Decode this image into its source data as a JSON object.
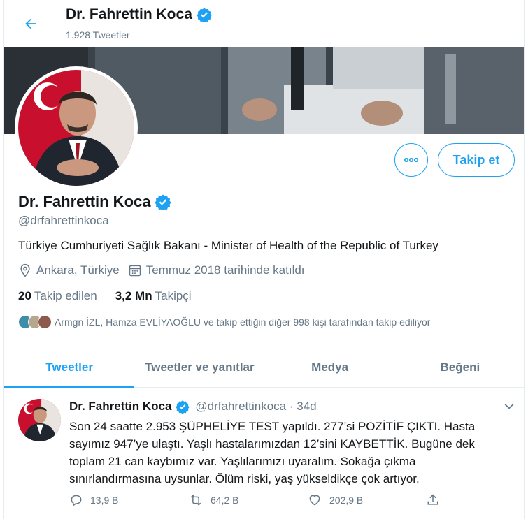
{
  "header": {
    "name": "Dr. Fahrettin Koca",
    "tweet_count": "1.928 Tweetler"
  },
  "profile": {
    "name": "Dr. Fahrettin Koca",
    "handle": "@drfahrettinkoca",
    "bio": "Türkiye Cumhuriyeti Sağlık Bakanı - Minister of Health of the Republic of Turkey",
    "location": "Ankara, Türkiye",
    "joined": "Temmuz 2018 tarihinde katıldı",
    "following_count": "20",
    "following_label": "Takip edilen",
    "followers_count": "3,2 Mn",
    "followers_label": "Takipçi",
    "followed_by": "Armgn İZL, Hamza EVLİYAOĞLU ve takip ettiğin diğer 998 kişi tarafından takip ediliyor",
    "follow_label": "Takip et"
  },
  "tabs": [
    {
      "label": "Tweetler"
    },
    {
      "label": "Tweetler ve yanıtlar"
    },
    {
      "label": "Medya"
    },
    {
      "label": "Beğeni"
    }
  ],
  "tweet": {
    "name": "Dr. Fahrettin Koca",
    "handle": "@drfahrettinkoca · 34d",
    "text": "Son 24 saatte 2.953 ŞÜPHELİYE TEST yapıldı. 277’si POZİTİF ÇIKTI. Hasta sayımız 947’ye ulaştı. Yaşlı hastalarımızdan 12’sini KAYBETTİK. Bugüne dek toplam 21 can kaybımız var. Yaşlılarımızı uyaralım. Sokağa çıkma sınırlandırmasına uysunlar. Ölüm riski, yaş yükseldikçe çok artıyor.",
    "replies": "13,9 B",
    "retweets": "64,2 B",
    "likes": "202,9 B"
  },
  "colors": {
    "accent": "#1da1f2",
    "muted": "#657786",
    "text": "#14171a"
  },
  "icons": [
    "back-arrow-icon",
    "verified-badge-icon",
    "more-icon",
    "location-icon",
    "calendar-icon",
    "reply-icon",
    "retweet-icon",
    "like-icon",
    "share-icon",
    "chevron-down-icon"
  ]
}
